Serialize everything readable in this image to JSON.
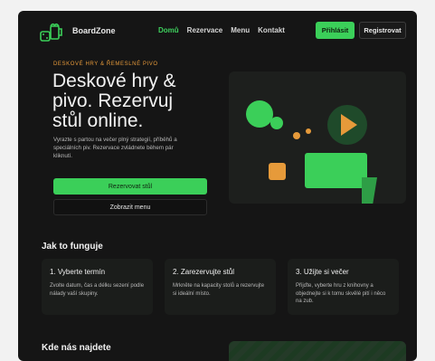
{
  "brand": {
    "name": "BoardZone"
  },
  "nav": {
    "links": [
      {
        "label": "Domů",
        "active": true
      },
      {
        "label": "Rezervace",
        "active": false
      },
      {
        "label": "Menu",
        "active": false
      },
      {
        "label": "Kontakt",
        "active": false
      }
    ],
    "login_label": "Přihlásit",
    "register_label": "Registrovat"
  },
  "hero": {
    "eyebrow": "DESKOVÉ HRY & ŘEMESLNÉ PIVO",
    "title": "Deskové hry & pivo. Rezervuj stůl online.",
    "text": "Vyrazte s partou na večer plný strategií, příběhů a speciálních piv. Rezervace zvládnete během pár kliknutí.",
    "reserve_label": "Rezervovat stůl",
    "menu_label": "Zobrazit menu"
  },
  "how": {
    "title": "Jak to funguje",
    "steps": [
      {
        "title": "1. Vyberte termín",
        "text": "Zvolte datum, čas a délku sezení podle nálady vaší skupiny."
      },
      {
        "title": "2. Zarezervujte stůl",
        "text": "Mrkněte na kapacity stolů a rezervujte si ideální místo."
      },
      {
        "title": "3. Užijte si večer",
        "text": "Přijďte, vyberte hru z knihovny a objednejte si k tomu skvělé pití i něco na zub."
      }
    ]
  },
  "find": {
    "title": "Kde nás najdete"
  },
  "colors": {
    "accent": "#3bcf59",
    "eyebrow": "#e69a3a",
    "background": "#151515"
  },
  "icons": {
    "logo": "dice-beer-mug-icon",
    "play": "play-icon"
  }
}
